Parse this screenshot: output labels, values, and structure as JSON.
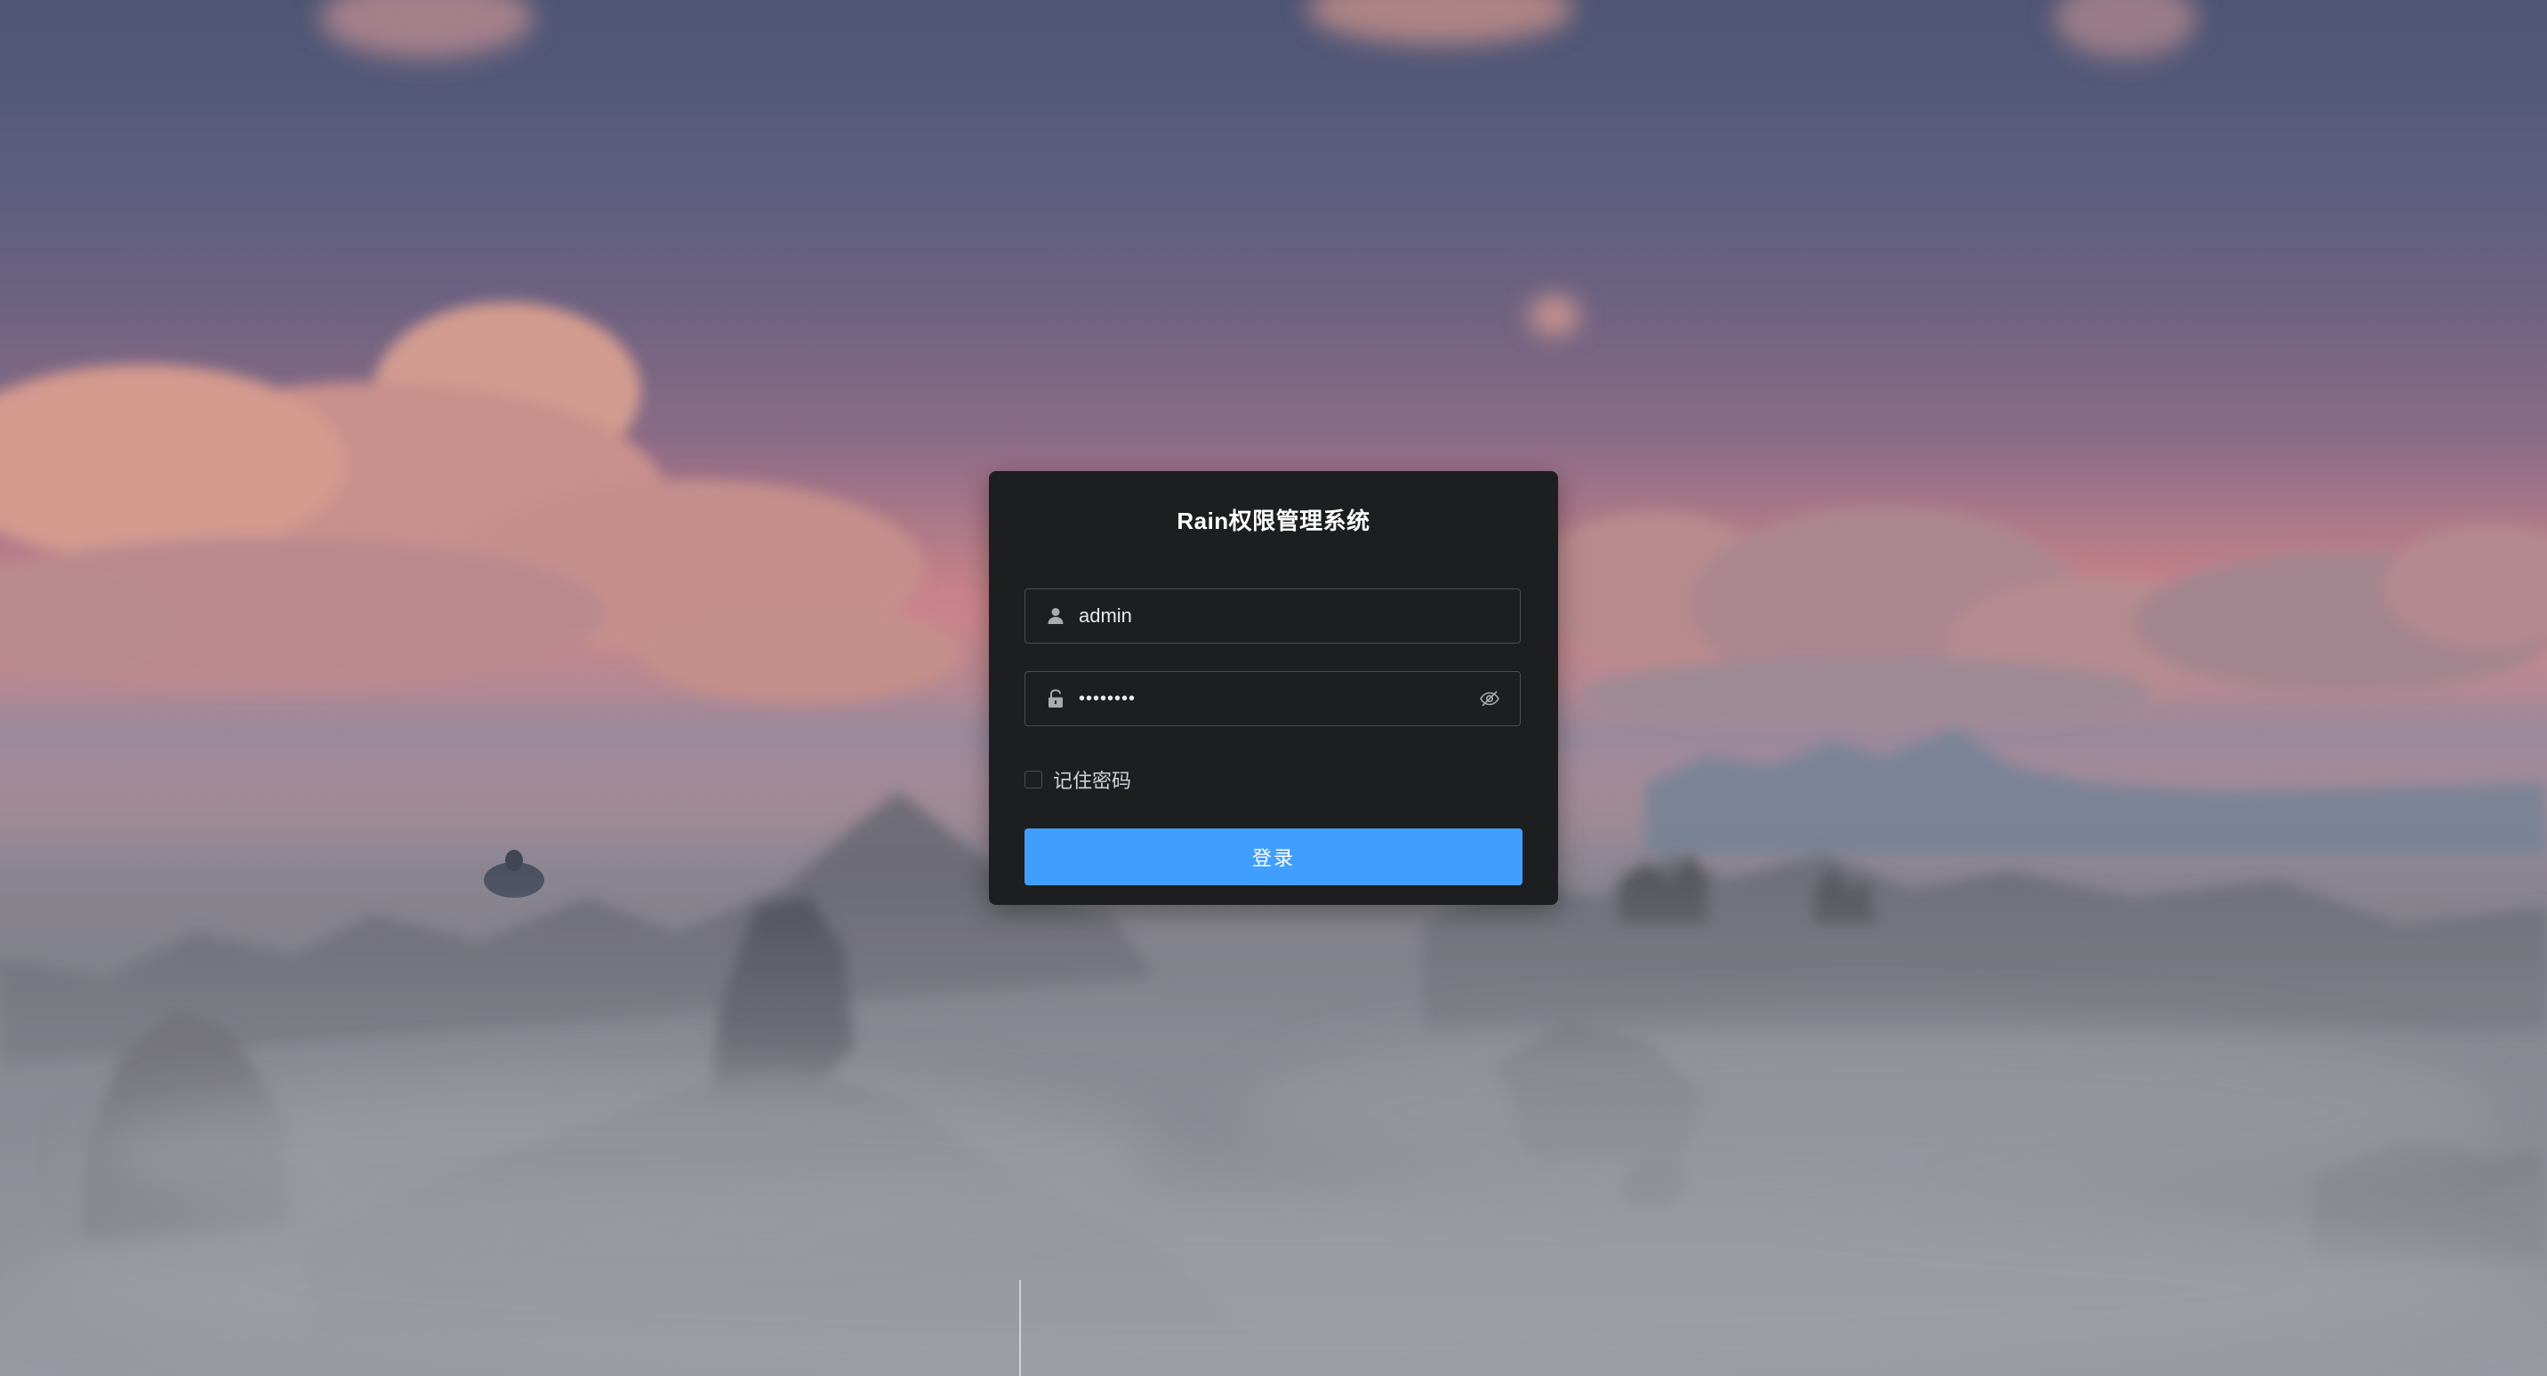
{
  "app": {
    "title": "Rain权限管理系统"
  },
  "login_form": {
    "username": {
      "value": "admin",
      "icon": "user-icon"
    },
    "password": {
      "value": "••••••••",
      "icon": "lock-icon",
      "toggle_icon": "eye-off-icon"
    },
    "remember": {
      "label": "记住密码",
      "checked": false
    },
    "submit_label": "登录"
  },
  "colors": {
    "card_background": "#1d1e1f",
    "primary": "#409eff",
    "input_border": "#4c4d4f",
    "text": "#ffffff"
  }
}
